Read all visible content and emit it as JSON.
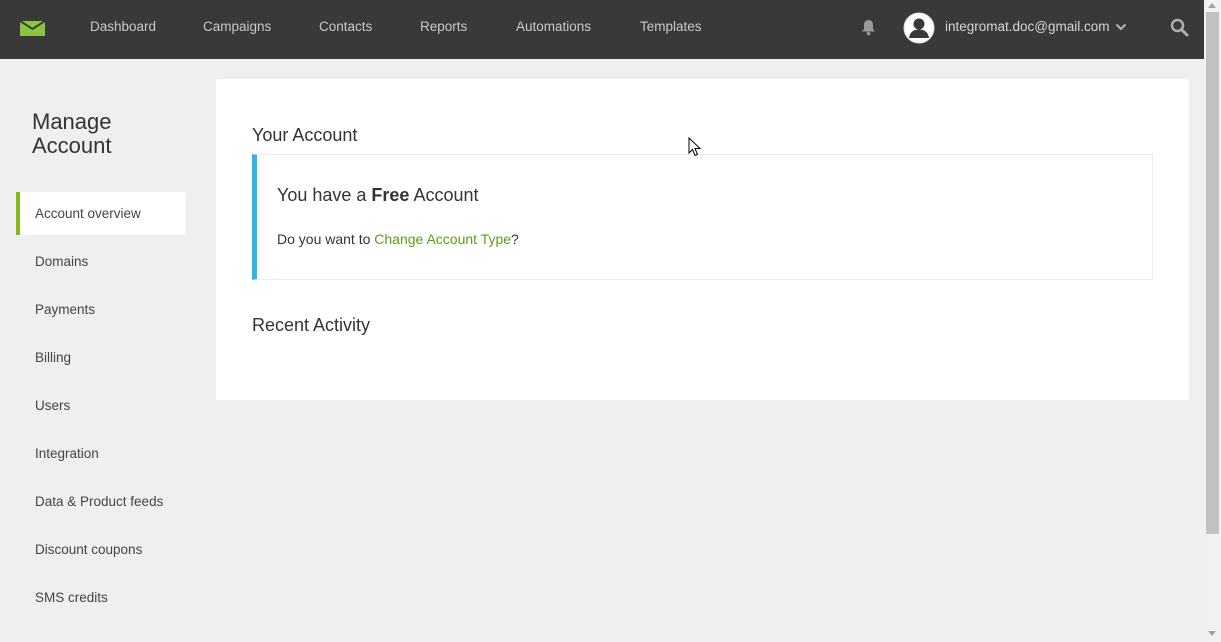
{
  "nav": {
    "items": [
      {
        "label": "Dashboard"
      },
      {
        "label": "Campaigns"
      },
      {
        "label": "Contacts"
      },
      {
        "label": "Reports"
      },
      {
        "label": "Automations"
      },
      {
        "label": "Templates"
      }
    ],
    "user_email": "integromat.doc@gmail.com"
  },
  "sidebar": {
    "heading": "Manage Account",
    "items": [
      {
        "label": "Account overview",
        "active": true
      },
      {
        "label": "Domains"
      },
      {
        "label": "Payments"
      },
      {
        "label": "Billing"
      },
      {
        "label": "Users"
      },
      {
        "label": "Integration"
      },
      {
        "label": "Data & Product feeds"
      },
      {
        "label": "Discount coupons"
      },
      {
        "label": "SMS credits"
      }
    ]
  },
  "main": {
    "your_account_title": "Your Account",
    "plan": {
      "prefix": "You have a ",
      "name": "Free",
      "suffix": " Account"
    },
    "change": {
      "prefix": "Do you want to ",
      "link": "Change Account Type",
      "suffix": "?"
    },
    "recent_activity_title": "Recent Activity"
  },
  "colors": {
    "topbar": "#393939",
    "accent_green": "#84b819",
    "link_green": "#5f9d17",
    "info_blue": "#38b2e3",
    "logo_green": "#8cc63f"
  }
}
